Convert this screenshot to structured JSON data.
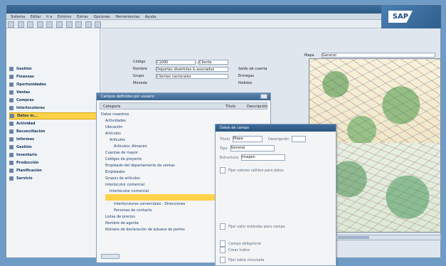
{
  "window": {
    "title": "SAP"
  },
  "menu": {
    "items": [
      "Sistema",
      "Editar",
      "Ir a",
      "Entorno",
      "Extras",
      "Opciones",
      "Herramientas",
      "Ayuda"
    ]
  },
  "left_panel": {
    "items": [
      {
        "label": "Gestión"
      },
      {
        "label": "Finanzas"
      },
      {
        "label": "Oportunidades"
      },
      {
        "label": "Ventas"
      },
      {
        "label": "Compras"
      },
      {
        "label": "Interlocutores"
      },
      {
        "label": "Datos m..."
      },
      {
        "label": "Actividad"
      },
      {
        "label": "Reconciliación"
      },
      {
        "label": "Informes"
      },
      {
        "label": "Gestión"
      },
      {
        "label": "Inventario"
      },
      {
        "label": "Producción"
      },
      {
        "label": "Planificación"
      },
      {
        "label": "Servicio"
      }
    ],
    "selected_index": 6
  },
  "form_top": {
    "codigo_label": "Código",
    "codigo_value": "C1000",
    "tipo_value": "Cliente",
    "nombre_label": "Nombre",
    "nombre_value": "Deportes divertidos & asociados",
    "grupo_label": "Grupo",
    "grupo_value": "Clientes nacionales",
    "moneda_label": "Moneda",
    "saldo_label": "Saldo de cuenta",
    "entregas_label": "Entregas",
    "pedidos_label": "Pedidos",
    "mapa_label": "Mapa",
    "combo_value": "General"
  },
  "dialog_fields": {
    "title": "Campos definidos por usuario",
    "col_categoria": "Categoría",
    "col_titulo": "Título",
    "col_descripcion": "Descripción",
    "rows": [
      {
        "label": "Datos maestros"
      },
      {
        "label": "Actividades"
      },
      {
        "label": "Ubicación"
      },
      {
        "label": "Artículos"
      },
      {
        "label": "Artículos"
      },
      {
        "label": "Artículos: Almacén"
      },
      {
        "label": "Cuentas de mayor"
      },
      {
        "label": "Códigos de proyecto"
      },
      {
        "label": "Empleado del departamento de ventas"
      },
      {
        "label": "Empleados"
      },
      {
        "label": "Grupos de artículos"
      },
      {
        "label": "Interlocutor comercial"
      },
      {
        "label": "Interlocutor comercial"
      },
      {
        "label": ""
      },
      {
        "label": "Interlocutores comerciales - Direcciones"
      },
      {
        "label": "Personas de contacto"
      },
      {
        "label": "Listas de precios"
      },
      {
        "label": "Nombre de agente"
      },
      {
        "label": "Número de declaración de aduana de portes"
      }
    ],
    "highlight_index": 13
  },
  "dialog_campo": {
    "title": "Datos de campo",
    "titulo_label": "Título",
    "titulo_value": "Mapa",
    "descripcion_label": "Descripción",
    "tipo_label": "Tipo",
    "tipo_value": "General",
    "estructura_label": "Estructura",
    "estructura_value": "Imagen",
    "opt1": "Fijar valores válidos para datos",
    "opt2": "Fijar valor estándar para campo",
    "opt3": "Campo obligatorio",
    "opt4": "Crear índice",
    "opt5": "Fijar tabla vinculada"
  }
}
